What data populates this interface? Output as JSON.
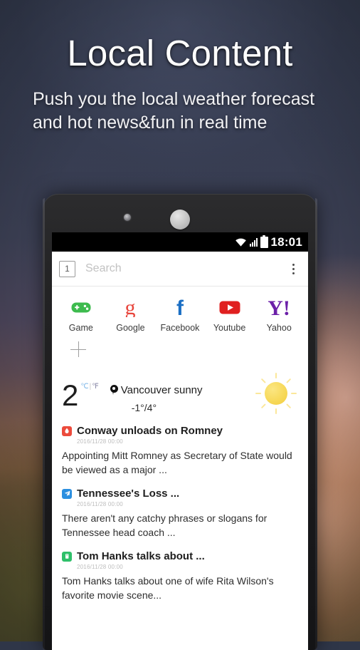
{
  "promo": {
    "title": "Local Content",
    "subtitle": "Push you the local weather forecast\nand hot news&fun in real time"
  },
  "phone": {
    "statusbar": {
      "time": "18:01",
      "icons": [
        "wifi-icon",
        "signal-icon",
        "battery-icon"
      ]
    },
    "search": {
      "tab_count": "1",
      "placeholder": "Search",
      "menu_icon": "kebab-menu-icon"
    },
    "shortcuts": [
      {
        "label": "Game",
        "icon": "gamepad-icon",
        "color": "#3dbb4e"
      },
      {
        "label": "Google",
        "icon": "google-g-icon",
        "color": "#e8453c"
      },
      {
        "label": "Facebook",
        "icon": "facebook-f-icon",
        "color": "#1b6fc4"
      },
      {
        "label": "Youtube",
        "icon": "youtube-play-icon",
        "color": "#e02020"
      },
      {
        "label": "Yahoo",
        "icon": "yahoo-y-icon",
        "color": "#6b1fa8"
      }
    ],
    "add_shortcut": {
      "icon": "plus-icon"
    },
    "weather": {
      "temperature": "2",
      "unit_celsius": "℃",
      "unit_divider": "|",
      "unit_fahrenheit": "℉",
      "location_icon": "location-pin-icon",
      "location": "Vancouver sunny",
      "range": "-1°/4°",
      "condition_icon": "sun-icon"
    },
    "news": [
      {
        "source_icon": "news-source-red-icon",
        "source_color": "#ec4b3c",
        "title": "Conway unloads on Romney",
        "date": "2016/11/28 00:00",
        "summary": "Appointing Mitt Romney as Secretary of State would be viewed as a major ..."
      },
      {
        "source_icon": "news-source-blue-icon",
        "source_color": "#2b8fe0",
        "title": "Tennessee's Loss ...",
        "date": "2016/11/28 00:00",
        "summary": "There aren't any catchy phrases or slogans for Tennessee head coach ..."
      },
      {
        "source_icon": "news-source-green-icon",
        "source_color": "#2fc06a",
        "title": "Tom Hanks talks about ...",
        "date": "2016/11/28 00:00",
        "summary": "Tom Hanks talks about one of wife Rita Wilson's favorite movie scene..."
      }
    ]
  }
}
